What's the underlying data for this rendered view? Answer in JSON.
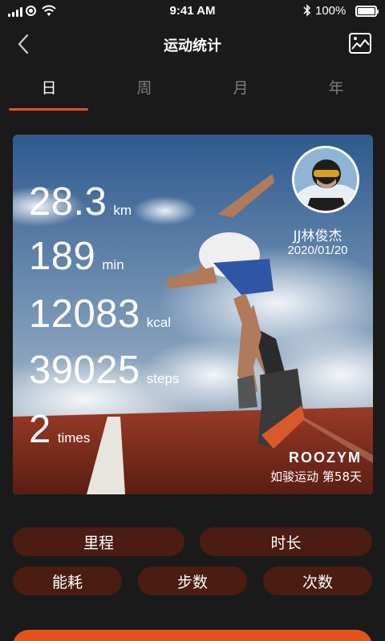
{
  "status_bar": {
    "time": "9:41 AM",
    "battery": "100%"
  },
  "nav": {
    "title": "运动统计",
    "back_icon": "chevron-left-icon",
    "action_icon": "image-chart-icon"
  },
  "tabs": [
    {
      "label": "日",
      "active": true
    },
    {
      "label": "周",
      "active": false
    },
    {
      "label": "月",
      "active": false
    },
    {
      "label": "年",
      "active": false
    }
  ],
  "card": {
    "stats": [
      {
        "value": "28.3",
        "unit": "km"
      },
      {
        "value": "189",
        "unit": "min"
      },
      {
        "value": "12083",
        "unit": "kcal"
      },
      {
        "value": "39025",
        "unit": "steps"
      },
      {
        "value": "2",
        "unit": "times"
      }
    ],
    "user_name": "JJ林俊杰",
    "date": "2020/01/20",
    "brand": "ROOZYM",
    "brand_tagline": "如骏运动 第58天"
  },
  "metrics": [
    "里程",
    "时长",
    "能耗",
    "步数",
    "次数"
  ],
  "colors": {
    "accent": "#e2541c",
    "pill": "#4a1c12",
    "background": "#1a1a1a"
  }
}
